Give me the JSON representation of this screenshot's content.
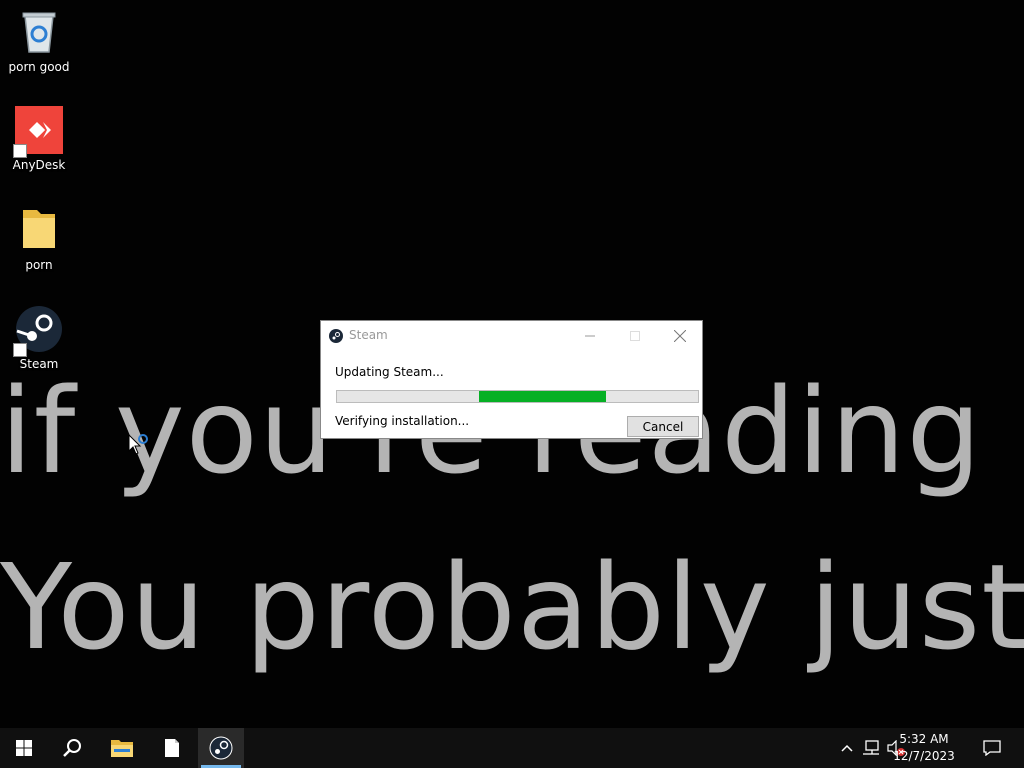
{
  "desktop": {
    "wallpaper_text": {
      "line1": "if you're reading this",
      "line2": "You probably just"
    },
    "icons": [
      {
        "label": "porn good",
        "icon": "recycle-bin-icon"
      },
      {
        "label": "AnyDesk",
        "icon": "anydesk-icon"
      },
      {
        "label": "porn",
        "icon": "folder-icon"
      },
      {
        "label": "Steam",
        "icon": "steam-icon"
      }
    ]
  },
  "dialog": {
    "title": "Steam",
    "status": "Updating Steam...",
    "detail": "Verifying installation...",
    "progress_indeterminate": true,
    "cancel_label": "Cancel"
  },
  "taskbar": {
    "items": [
      "start-icon",
      "search-icon",
      "file-explorer-icon",
      "notepad-icon",
      "steam-icon"
    ],
    "active_item": "steam-icon",
    "tray": [
      "chevron-up-icon",
      "network-icon",
      "volume-muted-icon",
      "notification-icon"
    ],
    "time": "5:32 AM",
    "date": "12/7/2023"
  },
  "colors": {
    "progress": "#06b025",
    "anydesk": "#ef443b",
    "steam": "#1b2838",
    "folder": "#f8d775",
    "taskbar_active": "#76b9ed"
  }
}
